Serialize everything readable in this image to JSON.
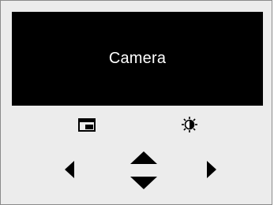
{
  "camera": {
    "label": "Camera"
  },
  "icons": {
    "fit": "fit-screen-icon",
    "brightness": "brightness-contrast-icon",
    "left": "arrow-left-icon",
    "up": "arrow-up-icon",
    "down": "arrow-down-icon",
    "right": "arrow-right-icon"
  },
  "colors": {
    "panel_background": "#ececec",
    "camera_background": "#000000",
    "camera_text": "#ffffff",
    "icon": "#000000",
    "border": "#8a8a8a"
  }
}
